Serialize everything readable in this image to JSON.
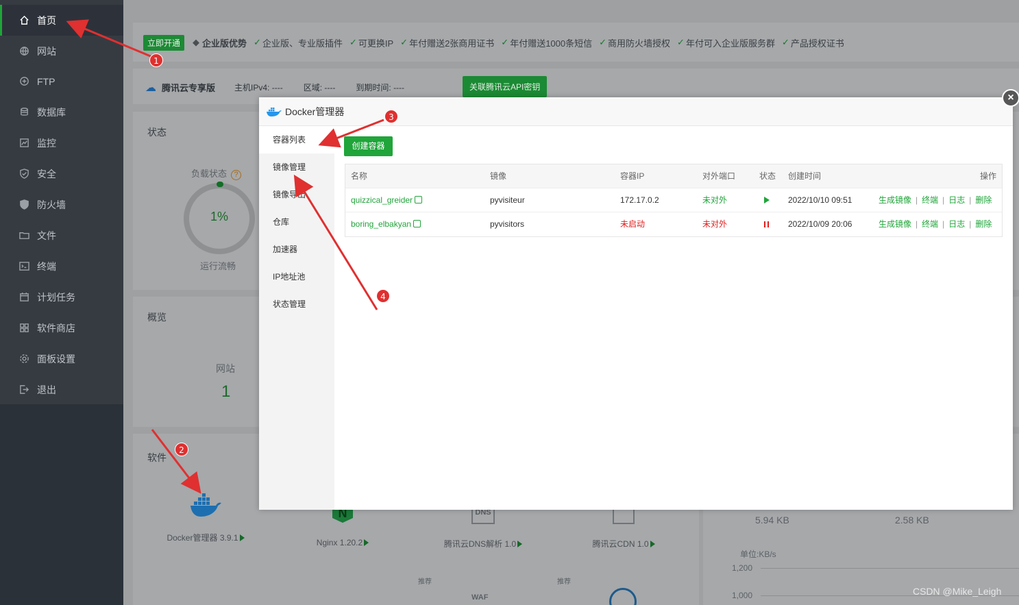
{
  "sidebar": {
    "items": [
      {
        "label": "首页",
        "icon": "home-icon",
        "active": true
      },
      {
        "label": "网站",
        "icon": "globe-icon"
      },
      {
        "label": "FTP",
        "icon": "ftp-icon"
      },
      {
        "label": "数据库",
        "icon": "database-icon"
      },
      {
        "label": "监控",
        "icon": "monitor-icon"
      },
      {
        "label": "安全",
        "icon": "shield-icon"
      },
      {
        "label": "防火墙",
        "icon": "firewall-icon"
      },
      {
        "label": "文件",
        "icon": "folder-icon"
      },
      {
        "label": "终端",
        "icon": "terminal-icon"
      },
      {
        "label": "计划任务",
        "icon": "calendar-icon"
      },
      {
        "label": "软件商店",
        "icon": "grid-icon"
      },
      {
        "label": "面板设置",
        "icon": "gear-icon"
      },
      {
        "label": "退出",
        "icon": "logout-icon"
      }
    ]
  },
  "promo": {
    "open_label": "立即开通",
    "enterprise": "企业版优势",
    "features": [
      "企业版、专业版插件",
      "可更换IP",
      "年付赠送2张商用证书",
      "年付赠送1000条短信",
      "商用防火墙授权",
      "年付可入企业版服务群",
      "产品授权证书"
    ]
  },
  "tencent": {
    "title": "腾讯云专享版",
    "ipv4_label": "主机IPv4:",
    "ipv4_value": "----",
    "region_label": "区域:",
    "region_value": "----",
    "expire_label": "到期时间:",
    "expire_value": "----",
    "api_button": "关联腾讯云API密钥"
  },
  "status_section": {
    "title": "状态",
    "load_label": "负载状态",
    "help": "?",
    "load_value": "1%",
    "load_text": "运行流畅"
  },
  "overview_section": {
    "title": "概览",
    "site_label": "网站",
    "site_count": "1"
  },
  "software_section": {
    "title": "软件",
    "items": [
      {
        "label": "Docker管理器 3.9.1"
      },
      {
        "label": "Nginx 1.20.2"
      },
      {
        "label": "腾讯云DNS解析 1.0"
      },
      {
        "label": "腾讯云CDN 1.0"
      }
    ],
    "recommend_tag": "推荐",
    "dns_text": "DNS",
    "waf_text": "WAF"
  },
  "traffic": {
    "up": "5.94 KB",
    "down": "2.58 KB",
    "unit": "单位:KB/s",
    "ticks": [
      "1,200",
      "1,000"
    ]
  },
  "modal": {
    "title": "Docker管理器",
    "close": "×",
    "nav": [
      "容器列表",
      "镜像管理",
      "镜像导出",
      "仓库",
      "加速器",
      "IP地址池",
      "状态管理"
    ],
    "create_button": "创建容器",
    "columns": [
      "名称",
      "镜像",
      "容器IP",
      "对外端口",
      "状态",
      "创建时间",
      "操作"
    ],
    "rows": [
      {
        "name": "quizzical_greider",
        "image": "pyvisiteur",
        "ip": "172.17.0.2",
        "port": "未对外",
        "status": "running",
        "created": "2022/10/10 09:51"
      },
      {
        "name": "boring_elbakyan",
        "image": "pyvisitors",
        "ip": "未启动",
        "port": "未对外",
        "status": "stopped",
        "created": "2022/10/09 20:06"
      }
    ],
    "ops": [
      "生成镜像",
      "终端",
      "日志",
      "删除"
    ]
  },
  "annotations": [
    "1",
    "2",
    "3",
    "4"
  ],
  "watermark": "CSDN @Mike_Leigh",
  "colors": {
    "accent": "#20a53a",
    "danger": "#e02020",
    "annotation": "#e03030"
  }
}
